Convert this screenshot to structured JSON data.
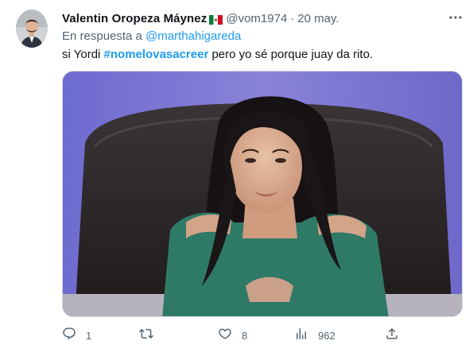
{
  "tweet": {
    "author_name": "Valentin Oropeza Máynez",
    "handle": "@vom1974",
    "separator": "·",
    "date": "20 may.",
    "reply_prefix": "En respuesta a",
    "reply_to": "@marthahigareda",
    "text_before": "si Yordi",
    "hashtag": "#nomelovasacreer",
    "text_after": "pero yo sé porque juay da rito."
  },
  "actions": {
    "replies": "1",
    "retweets": "",
    "likes": "8",
    "views": "962"
  },
  "icons": {
    "more": "more-options-icon",
    "reply": "reply-icon",
    "retweet": "retweet-icon",
    "like": "heart-icon",
    "views": "views-icon",
    "share": "share-icon",
    "flag": "mexico-flag-icon"
  },
  "colors": {
    "link": "#1d9bf0",
    "secondary_text": "#536471",
    "primary_text": "#0f1419"
  }
}
